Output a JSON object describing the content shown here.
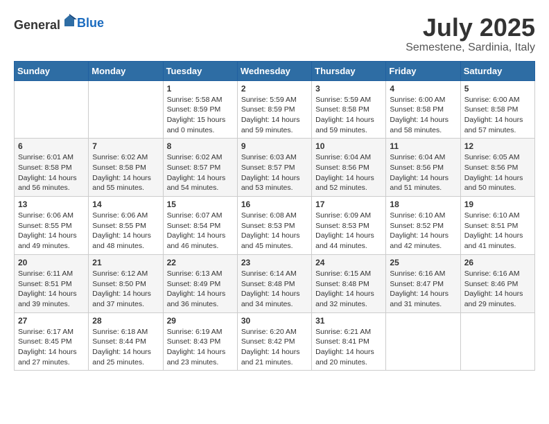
{
  "logo": {
    "general": "General",
    "blue": "Blue"
  },
  "title": {
    "month_year": "July 2025",
    "location": "Semestene, Sardinia, Italy"
  },
  "days_of_week": [
    "Sunday",
    "Monday",
    "Tuesday",
    "Wednesday",
    "Thursday",
    "Friday",
    "Saturday"
  ],
  "weeks": [
    [
      {
        "day": "",
        "content": ""
      },
      {
        "day": "",
        "content": ""
      },
      {
        "day": "1",
        "content": "Sunrise: 5:58 AM\nSunset: 8:59 PM\nDaylight: 15 hours\nand 0 minutes."
      },
      {
        "day": "2",
        "content": "Sunrise: 5:59 AM\nSunset: 8:59 PM\nDaylight: 14 hours\nand 59 minutes."
      },
      {
        "day": "3",
        "content": "Sunrise: 5:59 AM\nSunset: 8:58 PM\nDaylight: 14 hours\nand 59 minutes."
      },
      {
        "day": "4",
        "content": "Sunrise: 6:00 AM\nSunset: 8:58 PM\nDaylight: 14 hours\nand 58 minutes."
      },
      {
        "day": "5",
        "content": "Sunrise: 6:00 AM\nSunset: 8:58 PM\nDaylight: 14 hours\nand 57 minutes."
      }
    ],
    [
      {
        "day": "6",
        "content": "Sunrise: 6:01 AM\nSunset: 8:58 PM\nDaylight: 14 hours\nand 56 minutes."
      },
      {
        "day": "7",
        "content": "Sunrise: 6:02 AM\nSunset: 8:58 PM\nDaylight: 14 hours\nand 55 minutes."
      },
      {
        "day": "8",
        "content": "Sunrise: 6:02 AM\nSunset: 8:57 PM\nDaylight: 14 hours\nand 54 minutes."
      },
      {
        "day": "9",
        "content": "Sunrise: 6:03 AM\nSunset: 8:57 PM\nDaylight: 14 hours\nand 53 minutes."
      },
      {
        "day": "10",
        "content": "Sunrise: 6:04 AM\nSunset: 8:56 PM\nDaylight: 14 hours\nand 52 minutes."
      },
      {
        "day": "11",
        "content": "Sunrise: 6:04 AM\nSunset: 8:56 PM\nDaylight: 14 hours\nand 51 minutes."
      },
      {
        "day": "12",
        "content": "Sunrise: 6:05 AM\nSunset: 8:56 PM\nDaylight: 14 hours\nand 50 minutes."
      }
    ],
    [
      {
        "day": "13",
        "content": "Sunrise: 6:06 AM\nSunset: 8:55 PM\nDaylight: 14 hours\nand 49 minutes."
      },
      {
        "day": "14",
        "content": "Sunrise: 6:06 AM\nSunset: 8:55 PM\nDaylight: 14 hours\nand 48 minutes."
      },
      {
        "day": "15",
        "content": "Sunrise: 6:07 AM\nSunset: 8:54 PM\nDaylight: 14 hours\nand 46 minutes."
      },
      {
        "day": "16",
        "content": "Sunrise: 6:08 AM\nSunset: 8:53 PM\nDaylight: 14 hours\nand 45 minutes."
      },
      {
        "day": "17",
        "content": "Sunrise: 6:09 AM\nSunset: 8:53 PM\nDaylight: 14 hours\nand 44 minutes."
      },
      {
        "day": "18",
        "content": "Sunrise: 6:10 AM\nSunset: 8:52 PM\nDaylight: 14 hours\nand 42 minutes."
      },
      {
        "day": "19",
        "content": "Sunrise: 6:10 AM\nSunset: 8:51 PM\nDaylight: 14 hours\nand 41 minutes."
      }
    ],
    [
      {
        "day": "20",
        "content": "Sunrise: 6:11 AM\nSunset: 8:51 PM\nDaylight: 14 hours\nand 39 minutes."
      },
      {
        "day": "21",
        "content": "Sunrise: 6:12 AM\nSunset: 8:50 PM\nDaylight: 14 hours\nand 37 minutes."
      },
      {
        "day": "22",
        "content": "Sunrise: 6:13 AM\nSunset: 8:49 PM\nDaylight: 14 hours\nand 36 minutes."
      },
      {
        "day": "23",
        "content": "Sunrise: 6:14 AM\nSunset: 8:48 PM\nDaylight: 14 hours\nand 34 minutes."
      },
      {
        "day": "24",
        "content": "Sunrise: 6:15 AM\nSunset: 8:48 PM\nDaylight: 14 hours\nand 32 minutes."
      },
      {
        "day": "25",
        "content": "Sunrise: 6:16 AM\nSunset: 8:47 PM\nDaylight: 14 hours\nand 31 minutes."
      },
      {
        "day": "26",
        "content": "Sunrise: 6:16 AM\nSunset: 8:46 PM\nDaylight: 14 hours\nand 29 minutes."
      }
    ],
    [
      {
        "day": "27",
        "content": "Sunrise: 6:17 AM\nSunset: 8:45 PM\nDaylight: 14 hours\nand 27 minutes."
      },
      {
        "day": "28",
        "content": "Sunrise: 6:18 AM\nSunset: 8:44 PM\nDaylight: 14 hours\nand 25 minutes."
      },
      {
        "day": "29",
        "content": "Sunrise: 6:19 AM\nSunset: 8:43 PM\nDaylight: 14 hours\nand 23 minutes."
      },
      {
        "day": "30",
        "content": "Sunrise: 6:20 AM\nSunset: 8:42 PM\nDaylight: 14 hours\nand 21 minutes."
      },
      {
        "day": "31",
        "content": "Sunrise: 6:21 AM\nSunset: 8:41 PM\nDaylight: 14 hours\nand 20 minutes."
      },
      {
        "day": "",
        "content": ""
      },
      {
        "day": "",
        "content": ""
      }
    ]
  ]
}
